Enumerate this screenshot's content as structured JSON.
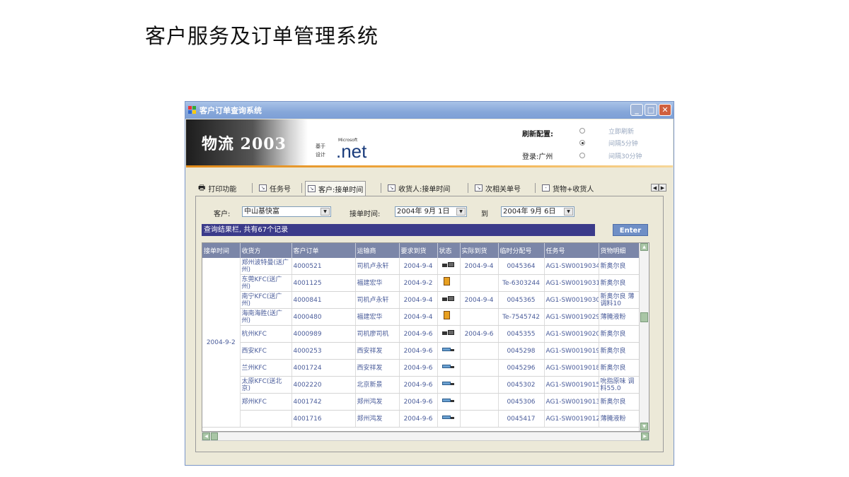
{
  "slide_title": "客户服务及订单管理系统",
  "window": {
    "title": "客户订单查询系统",
    "min": "_",
    "max": "□",
    "close": "✕"
  },
  "banner": {
    "logo": "物流 2003",
    "based_on": "基于",
    "design": "设计",
    "microsoft": "Microsoft",
    "net": ".net",
    "refresh_config": "刷新配置:",
    "login": "登录:广州",
    "radio_options": [
      "立即刷新",
      "间隔5分钟",
      "间隔30分钟"
    ],
    "radio_selected": 1
  },
  "toolbar": {
    "print": "打印功能",
    "tabs": [
      "任务号",
      "客户:接单时间",
      "收货人:接单时间",
      "次相关单号",
      "货物+收货人"
    ],
    "active_tab": 1
  },
  "filters": {
    "customer_label": "客户:",
    "customer_value": "中山基快富",
    "order_time_label": "接单时间:",
    "date_from": "2004年 9月 1日",
    "to_label": "到",
    "date_to": "2004年 9月 6日"
  },
  "result_text": "查询结果栏, 共有67个记录",
  "enter_label": "Enter",
  "table": {
    "columns": [
      "接单时间",
      "收货方",
      "客户订单",
      "运输商",
      "要求到货",
      "状态",
      "实际到货",
      "临时分配号",
      "任务号",
      "货物明细"
    ],
    "group_date": "2004-9-2",
    "rows": [
      {
        "receiver": "郑州波特曼(送广州)",
        "order": "4000521",
        "carrier": "司机卢永轩",
        "req": "2004-9-4",
        "status": "delivered",
        "actual": "2004-9-4",
        "temp": "0045364",
        "task": "AG1-SW0019034",
        "goods": "新奥尔良"
      },
      {
        "receiver": "东莞KFC(送广州)",
        "order": "4001125",
        "carrier": "福建宏华",
        "req": "2004-9-2",
        "status": "warehouse",
        "actual": "",
        "temp": "Te-6303244",
        "task": "AG1-SW0019031",
        "goods": "新奥尔良"
      },
      {
        "receiver": "南宁KFC(送广州)",
        "order": "4000841",
        "carrier": "司机卢永轩",
        "req": "2004-9-4",
        "status": "delivered",
        "actual": "2004-9-4",
        "temp": "0045365",
        "task": "AG1-SW0019030",
        "goods": "新奥尔良 薄调料10"
      },
      {
        "receiver": "海南海胜(送广州)",
        "order": "4000480",
        "carrier": "福建宏华",
        "req": "2004-9-4",
        "status": "warehouse",
        "actual": "",
        "temp": "Te-7545742",
        "task": "AG1-SW0019029",
        "goods": "薄腌液粉"
      },
      {
        "receiver": "杭州KFC",
        "order": "4000989",
        "carrier": "司机廖司机",
        "req": "2004-9-6",
        "status": "delivered",
        "actual": "2004-9-6",
        "temp": "0045355",
        "task": "AG1-SW0019020",
        "goods": "新奥尔良"
      },
      {
        "receiver": "西安KFC",
        "order": "4000253",
        "carrier": "西安祥发",
        "req": "2004-9-6",
        "status": "truck",
        "actual": "",
        "temp": "0045298",
        "task": "AG1-SW0019019",
        "goods": "新奥尔良"
      },
      {
        "receiver": "兰州KFC",
        "order": "4001724",
        "carrier": "西安祥发",
        "req": "2004-9-6",
        "status": "truck",
        "actual": "",
        "temp": "0045296",
        "task": "AG1-SW0019018",
        "goods": "新奥尔良"
      },
      {
        "receiver": "太原KFC(送北京)",
        "order": "4002220",
        "carrier": "北京新景",
        "req": "2004-9-6",
        "status": "truck",
        "actual": "",
        "temp": "0045302",
        "task": "AG1-SW0019015",
        "goods": "吮指原味 调料55.0"
      },
      {
        "receiver": "郑州KFC",
        "order": "4001742",
        "carrier": "郑州鸿发",
        "req": "2004-9-6",
        "status": "truck",
        "actual": "",
        "temp": "0045306",
        "task": "AG1-SW0019013",
        "goods": "新奥尔良"
      },
      {
        "receiver": "",
        "order": "4001716",
        "carrier": "郑州鸿发",
        "req": "2004-9-6",
        "status": "truck",
        "actual": "",
        "temp": "0045417",
        "task": "AG1-SW0019012",
        "goods": "薄腌液粉"
      }
    ]
  }
}
